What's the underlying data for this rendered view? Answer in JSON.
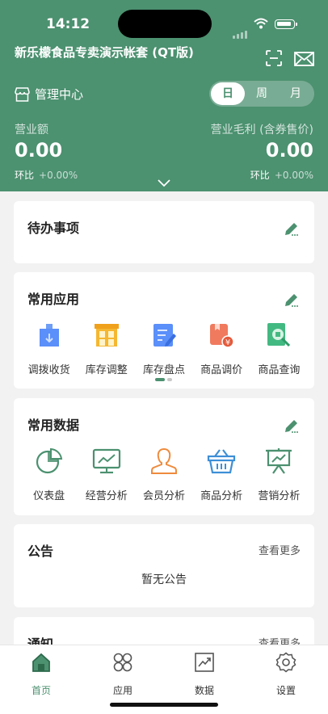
{
  "status_bar": {
    "time": "14:12"
  },
  "header": {
    "store_name": "新乐檬食品专卖演示帐套 (QT版)",
    "management_label": "管理中心",
    "period_tabs": [
      {
        "label": "日",
        "active": true
      },
      {
        "label": "周",
        "active": false
      },
      {
        "label": "月",
        "active": false
      }
    ],
    "revenue": {
      "label": "营业额",
      "value": "0.00",
      "ring_label": "环比",
      "ring_value": "+0.00%"
    },
    "gross_profit": {
      "label": "营业毛利 (含券售价)",
      "value": "0.00",
      "ring_label": "环比",
      "ring_value": "+0.00%"
    }
  },
  "todo": {
    "title": "待办事项"
  },
  "common_apps": {
    "title": "常用应用",
    "items": [
      {
        "label": "调拨收货",
        "icon": "transfer-receive-icon"
      },
      {
        "label": "库存调整",
        "icon": "inventory-adjust-icon"
      },
      {
        "label": "库存盘点",
        "icon": "stocktake-icon"
      },
      {
        "label": "商品调价",
        "icon": "price-adjust-icon"
      },
      {
        "label": "商品查询",
        "icon": "product-search-icon"
      }
    ],
    "pager": {
      "pages": 2,
      "current": 1
    }
  },
  "common_data": {
    "title": "常用数据",
    "items": [
      {
        "label": "仪表盘",
        "icon": "dashboard-icon"
      },
      {
        "label": "经营分析",
        "icon": "business-analysis-icon"
      },
      {
        "label": "会员分析",
        "icon": "member-analysis-icon"
      },
      {
        "label": "商品分析",
        "icon": "product-analysis-icon"
      },
      {
        "label": "营销分析",
        "icon": "marketing-analysis-icon"
      }
    ]
  },
  "announcement": {
    "title": "公告",
    "more": "查看更多",
    "empty": "暂无公告"
  },
  "notification": {
    "title": "通知",
    "more": "查看更多"
  },
  "tabbar": [
    {
      "label": "首页",
      "icon": "home-icon",
      "active": true
    },
    {
      "label": "应用",
      "icon": "apps-icon",
      "active": false
    },
    {
      "label": "数据",
      "icon": "chart-icon",
      "active": false
    },
    {
      "label": "设置",
      "icon": "settings-icon",
      "active": false
    }
  ],
  "colors": {
    "brand": "#4c9170",
    "edit": "#4c9170",
    "app_blue": "#5b8ff9",
    "app_yellow": "#f5b731",
    "app_red": "#f07a5e",
    "app_green": "#43b982",
    "data_orange": "#ef8a3c",
    "data_blue": "#3d8fd6"
  }
}
